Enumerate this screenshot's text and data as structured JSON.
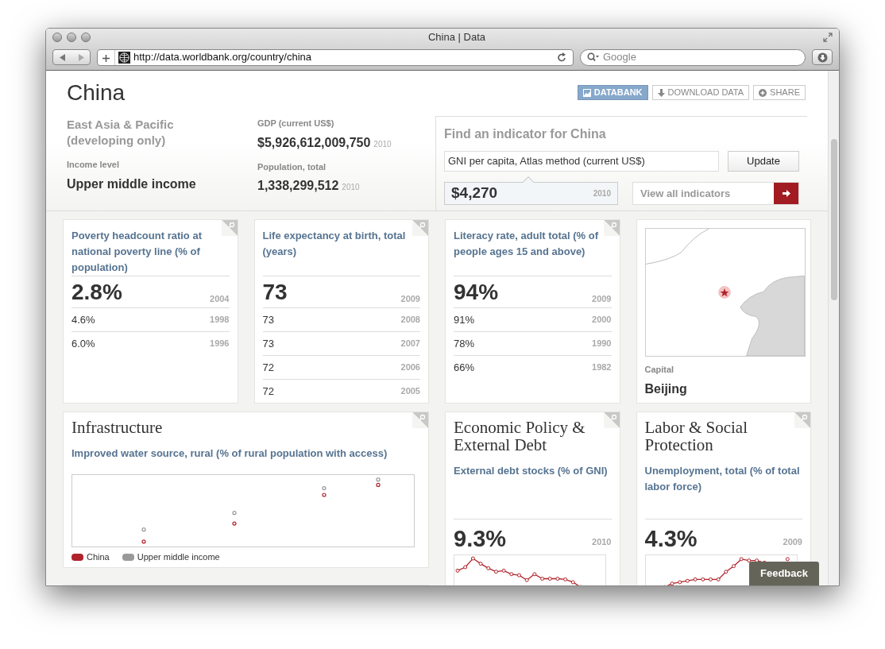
{
  "window": {
    "title": "China | Data",
    "url": "http://data.worldbank.org/country/china",
    "search_placeholder": "Google"
  },
  "header": {
    "country": "China",
    "buttons": [
      {
        "label": "DATABANK",
        "kind": "primary"
      },
      {
        "label": "DOWNLOAD DATA",
        "kind": "download"
      },
      {
        "label": "SHARE",
        "kind": "share"
      }
    ],
    "region": "East Asia & Pacific (developing only)",
    "income_label": "Income level",
    "income_value": "Upper middle income",
    "stats": [
      {
        "label": "GDP (current US$)",
        "value": "$5,926,612,009,750",
        "year": "2010"
      },
      {
        "label": "Population, total",
        "value": "1,338,299,512",
        "year": "2010"
      }
    ],
    "finder": {
      "title": "Find an indicator for China",
      "value": "GNI per capita, Atlas method (current US$)",
      "button": "Update",
      "result": "$4,270",
      "result_year": "2010",
      "view_all": "View all indicators"
    }
  },
  "indicator_cards": [
    {
      "title": "Poverty headcount ratio at national poverty line (% of population)",
      "rows": [
        {
          "value": "2.8%",
          "year": "2004"
        },
        {
          "value": "4.6%",
          "year": "1998"
        },
        {
          "value": "6.0%",
          "year": "1996"
        }
      ]
    },
    {
      "title": "Life expectancy at birth, total (years)",
      "rows": [
        {
          "value": "73",
          "year": "2009"
        },
        {
          "value": "73",
          "year": "2008"
        },
        {
          "value": "73",
          "year": "2007"
        },
        {
          "value": "72",
          "year": "2006"
        },
        {
          "value": "72",
          "year": "2005"
        }
      ]
    },
    {
      "title": "Literacy rate, adult total (% of people ages 15 and above)",
      "rows": [
        {
          "value": "94%",
          "year": "2009"
        },
        {
          "value": "91%",
          "year": "2000"
        },
        {
          "value": "78%",
          "year": "1990"
        },
        {
          "value": "66%",
          "year": "1982"
        }
      ]
    }
  ],
  "capital_card": {
    "label": "Capital",
    "value": "Beijing"
  },
  "topic_cards": [
    {
      "kind": "scatter",
      "title": "Infrastructure",
      "subtitle": "Improved water source, rural (% of rural population with access)",
      "legend": [
        {
          "name": "China",
          "color": "#b0232a"
        },
        {
          "name": "Upper middle income",
          "color": "#999999"
        }
      ]
    },
    {
      "kind": "sparkline",
      "title": "Economic Policy & External Debt",
      "subtitle": "External debt stocks (% of GNI)",
      "value": "9.3%",
      "year": "2010"
    },
    {
      "kind": "sparkline",
      "title": "Labor & Social Protection",
      "subtitle": "Unemployment, total (% of total labor force)",
      "value": "4.3%",
      "year": "2009"
    }
  ],
  "feedback": "Feedback"
}
